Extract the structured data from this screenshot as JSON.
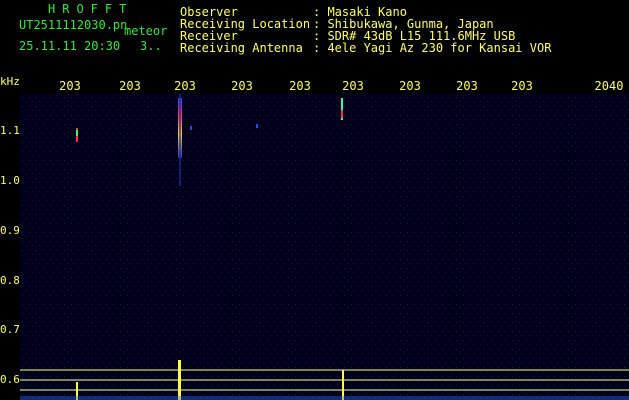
{
  "header": {
    "logo": "HROFFT",
    "filename": "UT2511112030.pn",
    "meteor_label": "meteor",
    "datetime": "25.11.11 20:30",
    "count": "3..",
    "meta_labels": "Observer\nReceiving Location\nReceiver\nReceiving Antenna",
    "meta_values": ": Masaki Kano\n: Shibukawa, Gunma, Japan\n: SDR# 43dB L15 111.6MHz USB\n: 4ele Yagi Az 230 for Kansai VOR"
  },
  "axes": {
    "unit": "kHz",
    "x_ticks": [
      "203",
      "203",
      "203",
      "203",
      "203",
      "203",
      "203",
      "203",
      "203",
      "2040"
    ],
    "y_ticks": [
      "1.1",
      "1.0",
      "0.9",
      "0.8",
      "0.7",
      "0.6"
    ]
  },
  "colors": {
    "text_green": "#35e835",
    "text_yellow": "#ffff66",
    "background": "#000000",
    "plot_background": "#00001a"
  }
}
